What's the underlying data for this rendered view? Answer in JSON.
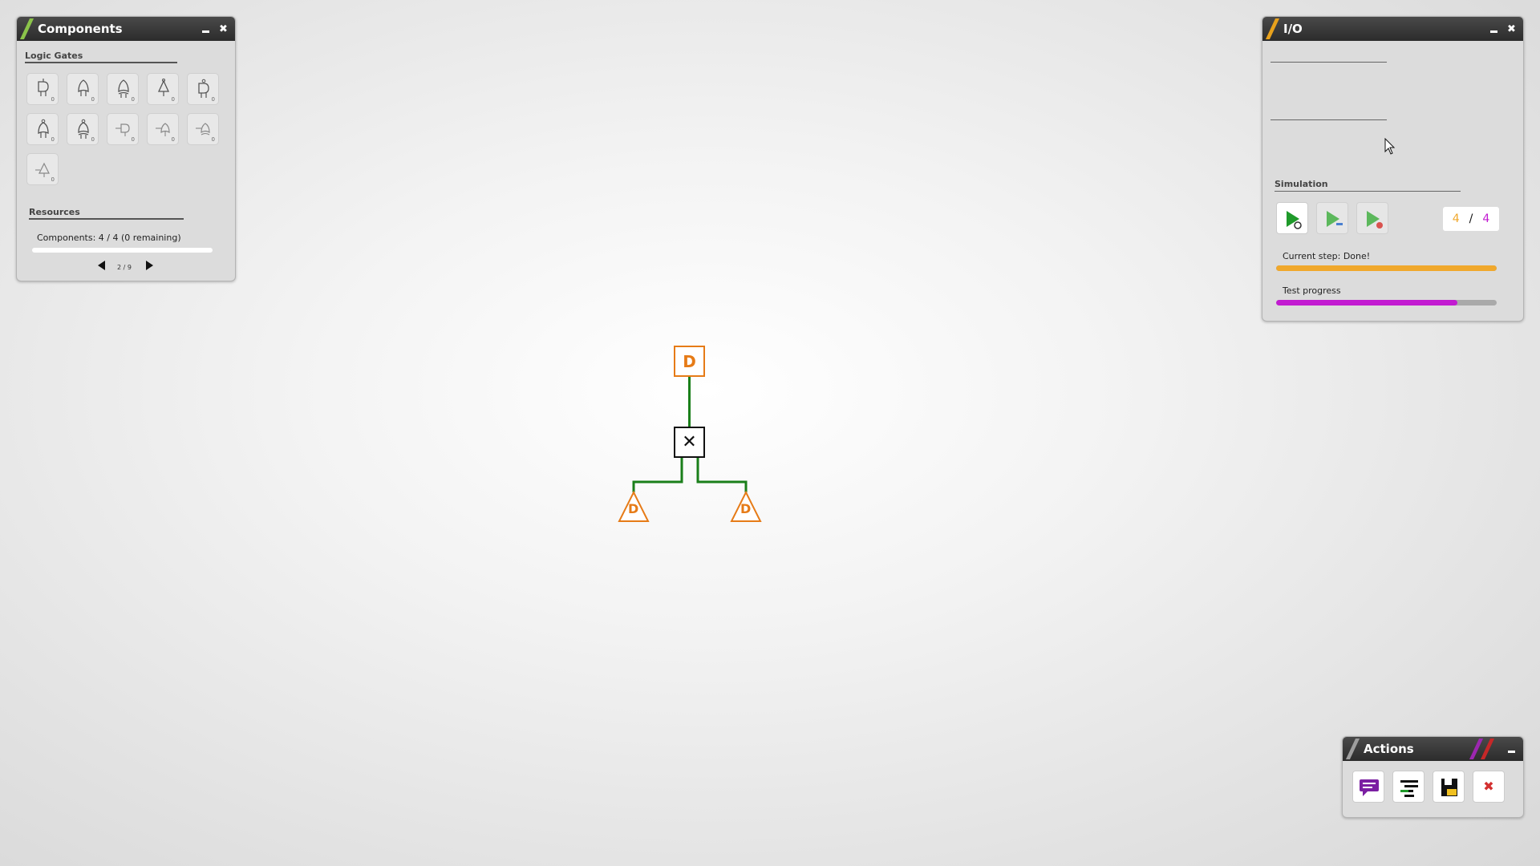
{
  "components": {
    "title": "Components",
    "logic_gates_label": "Logic Gates",
    "gates": [
      {
        "icon": "and-gate-icon",
        "count": "0"
      },
      {
        "icon": "or-gate-icon",
        "count": "0"
      },
      {
        "icon": "xor-gate-icon",
        "count": "0"
      },
      {
        "icon": "not-gate-icon",
        "count": "0"
      },
      {
        "icon": "nand-gate-icon",
        "count": "0"
      },
      {
        "icon": "nor-gate-icon",
        "count": "0"
      },
      {
        "icon": "xnor-gate-icon",
        "count": "0"
      },
      {
        "icon": "and-gate-alt-icon",
        "count": "0"
      },
      {
        "icon": "or-gate-alt-icon",
        "count": "0"
      },
      {
        "icon": "xor-gate-alt-icon",
        "count": "0"
      },
      {
        "icon": "not-gate-alt-icon",
        "count": "0"
      }
    ],
    "resources_label": "Resources",
    "resources_text": "Components: 4 / 4 (0 remaining)",
    "pager_text": "2 / 9"
  },
  "io": {
    "title": "I/O",
    "simulation_label": "Simulation",
    "counter_left": "4",
    "counter_sep": "/",
    "counter_right": "4",
    "current_step_label": "Current step:",
    "current_step_value": "Done!",
    "current_step_progress": 1.0,
    "test_progress_label": "Test progress",
    "test_progress": 0.82
  },
  "actions": {
    "title": "Actions",
    "buttons": [
      "chat-icon",
      "layers-icon",
      "save-icon",
      "delete-icon"
    ]
  },
  "circuit": {
    "node_label": "D",
    "center_symbol": "✕"
  },
  "colors": {
    "orange": "#e67b17",
    "green": "#1a7f1a",
    "purple": "#c21bd1",
    "yellow": "#f0a82c"
  }
}
